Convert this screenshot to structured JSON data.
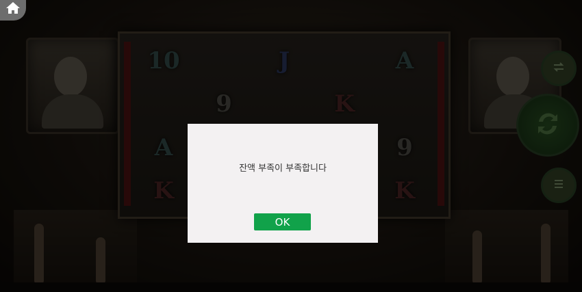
{
  "dialog": {
    "message": "잔액 부족이 부족합니다",
    "ok_label": "OK"
  },
  "reels": {
    "rows": [
      [
        "10",
        "",
        "J",
        "",
        "A"
      ],
      [
        "",
        "9",
        "",
        "K",
        ""
      ],
      [
        "A",
        "",
        "",
        "",
        "9"
      ],
      [
        "K",
        "",
        "",
        "",
        "K"
      ]
    ]
  },
  "icons": {
    "home": "home-icon",
    "swap": "swap-icon",
    "spin": "spin-arrows-icon",
    "menu": "menu-icon"
  },
  "colors": {
    "ok_button": "#11a24a",
    "dialog_bg": "#f3f1f2",
    "overlay": "rgba(0,0,0,0.55)"
  }
}
